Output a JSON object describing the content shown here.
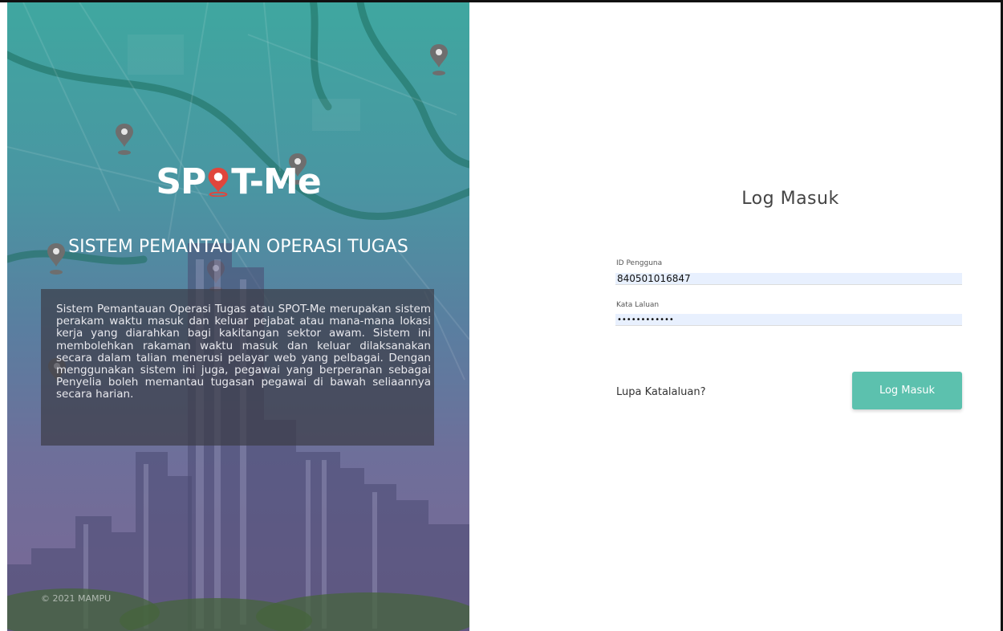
{
  "hero": {
    "logo_parts": [
      "SP",
      "T-Me"
    ],
    "title": "SISTEM PEMANTAUAN OPERASI TUGAS",
    "description": "Sistem Pemantauan Operasi Tugas atau SPOT-Me merupakan sistem perakam waktu masuk dan keluar pejabat atau mana-mana lokasi kerja yang diarahkan bagi kakitangan sektor awam. Sistem ini membolehkan rakaman waktu masuk dan keluar dilaksanakan secara dalam talian menerusi pelayar web yang pelbagai. Dengan menggunakan sistem ini juga, pegawai yang berperanan sebagai Penyelia boleh memantau tugasan pegawai di bawah seliaannya secara harian.",
    "copyright": "© 2021 MAMPU"
  },
  "login": {
    "title": "Log Masuk",
    "user_id_label": "ID Pengguna",
    "user_id_value": "840501016847",
    "password_label": "Kata Laluan",
    "password_value": "••••••••••••",
    "forgot_link": "Lupa Katalaluan?",
    "submit_label": "Log Masuk"
  },
  "colors": {
    "accent": "#5cc1ae",
    "pin_red": "#e0463c",
    "map_pin_gray": "#6e6e6e",
    "autofill_bg": "#e8f0fe"
  }
}
